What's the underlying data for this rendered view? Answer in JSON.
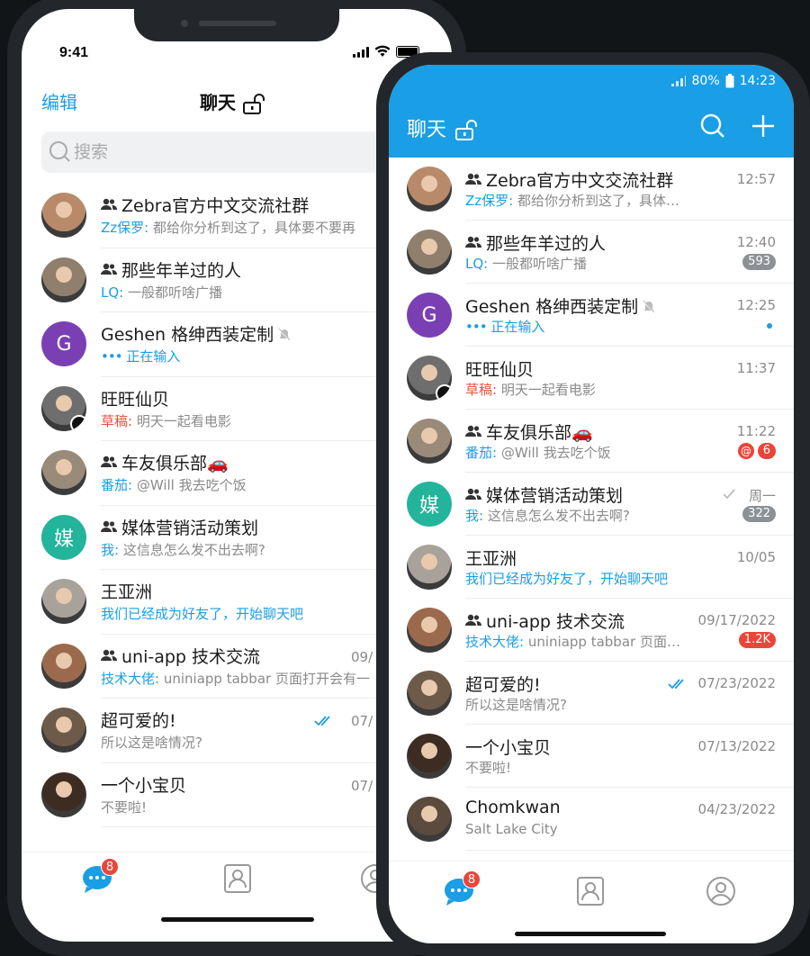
{
  "ios": {
    "time": "9:41",
    "edit": "编辑",
    "title": "聊天",
    "search_placeholder": "搜索",
    "tab_badge": "8"
  },
  "android": {
    "signal": "",
    "battery": "80%",
    "time": "14:23",
    "title": "聊天",
    "tab_badge": "8"
  },
  "colors": {
    "accent": "#1a9ee5",
    "badge_red": "#e9463a",
    "badge_grey": "#8c9196",
    "purple": "#7b3fb4",
    "teal": "#24b49b"
  },
  "ios_chats": [
    {
      "name": "Zebra官方中文交流社群",
      "group": true,
      "who": "Zz保罗:",
      "msg": "都给你分析到这了，具体要不要再",
      "time": ""
    },
    {
      "name": "那些年羊过的人",
      "group": true,
      "who": "LQ:",
      "msg": "一般都听啥广播",
      "time": ""
    },
    {
      "name": "Geshen 格绅西装定制",
      "muted": true,
      "letter": "G",
      "typing": "正在输入",
      "time": ""
    },
    {
      "name": "旺旺仙贝",
      "who": "草稿:",
      "msg": "明天一起看电影",
      "time": ""
    },
    {
      "name": "车友俱乐部🚗",
      "group": true,
      "who": "番茄:",
      "msg": "@Will 我去吃个饭",
      "time": ""
    },
    {
      "name": "媒体营销活动策划",
      "group": true,
      "letter": "媒",
      "who": "我:",
      "msg": "这信息怎么发不出去啊?",
      "time": ""
    },
    {
      "name": "王亚洲",
      "msg_blue": "我们已经成为好友了，开始聊天吧",
      "time": ""
    },
    {
      "name": "uni-app 技术交流",
      "group": true,
      "who": "技术大佬:",
      "msg": "uniniapp tabbar 页面打开会有一",
      "time": "09/"
    },
    {
      "name": "超可爱的!",
      "msg": "所以这是啥情况?",
      "time": "07/"
    },
    {
      "name": "一个小宝贝",
      "msg": "不要啦!",
      "time": "07/"
    }
  ],
  "android_chats": [
    {
      "name": "Zebra官方中文交流社群",
      "group": true,
      "who": "Zz保罗:",
      "msg": "都给你分析到这了，具体要不要再给...",
      "time": "12:57"
    },
    {
      "name": "那些年羊过的人",
      "group": true,
      "who": "LQ:",
      "msg": "一般都听啥广播",
      "time": "12:40",
      "count": "593"
    },
    {
      "name": "Geshen 格绅西装定制",
      "muted": true,
      "letter": "G",
      "typing": "正在输入",
      "time": "12:25",
      "dot": true
    },
    {
      "name": "旺旺仙贝",
      "who": "草稿:",
      "msg": "明天一起看电影",
      "time": "11:37"
    },
    {
      "name": "车友俱乐部🚗",
      "group": true,
      "who": "番茄:",
      "msg": "@Will 我去吃个饭",
      "time": "11:22",
      "mention": "@",
      "count_red": "6"
    },
    {
      "name": "媒体营销活动策划",
      "group": true,
      "letter": "媒",
      "who": "我:",
      "msg": "这信息怎么发不出去啊?",
      "time": "周一",
      "count": "322",
      "sent": true
    },
    {
      "name": "王亚洲",
      "msg_blue": "我们已经成为好友了，开始聊天吧",
      "time": "10/05"
    },
    {
      "name": "uni-app 技术交流",
      "group": true,
      "who": "技术大佬:",
      "msg": "uniniapp tabbar 页面打开会有...",
      "time": "09/17/2022",
      "count_red": "1.2K"
    },
    {
      "name": "超可爱的!",
      "msg": "所以这是啥情况?",
      "time": "07/23/2022",
      "read": true
    },
    {
      "name": "一个小宝贝",
      "msg": "不要啦!",
      "time": "07/13/2022"
    },
    {
      "name": "Chomkwan",
      "msg": "Salt Lake City",
      "time": "04/23/2022"
    }
  ]
}
